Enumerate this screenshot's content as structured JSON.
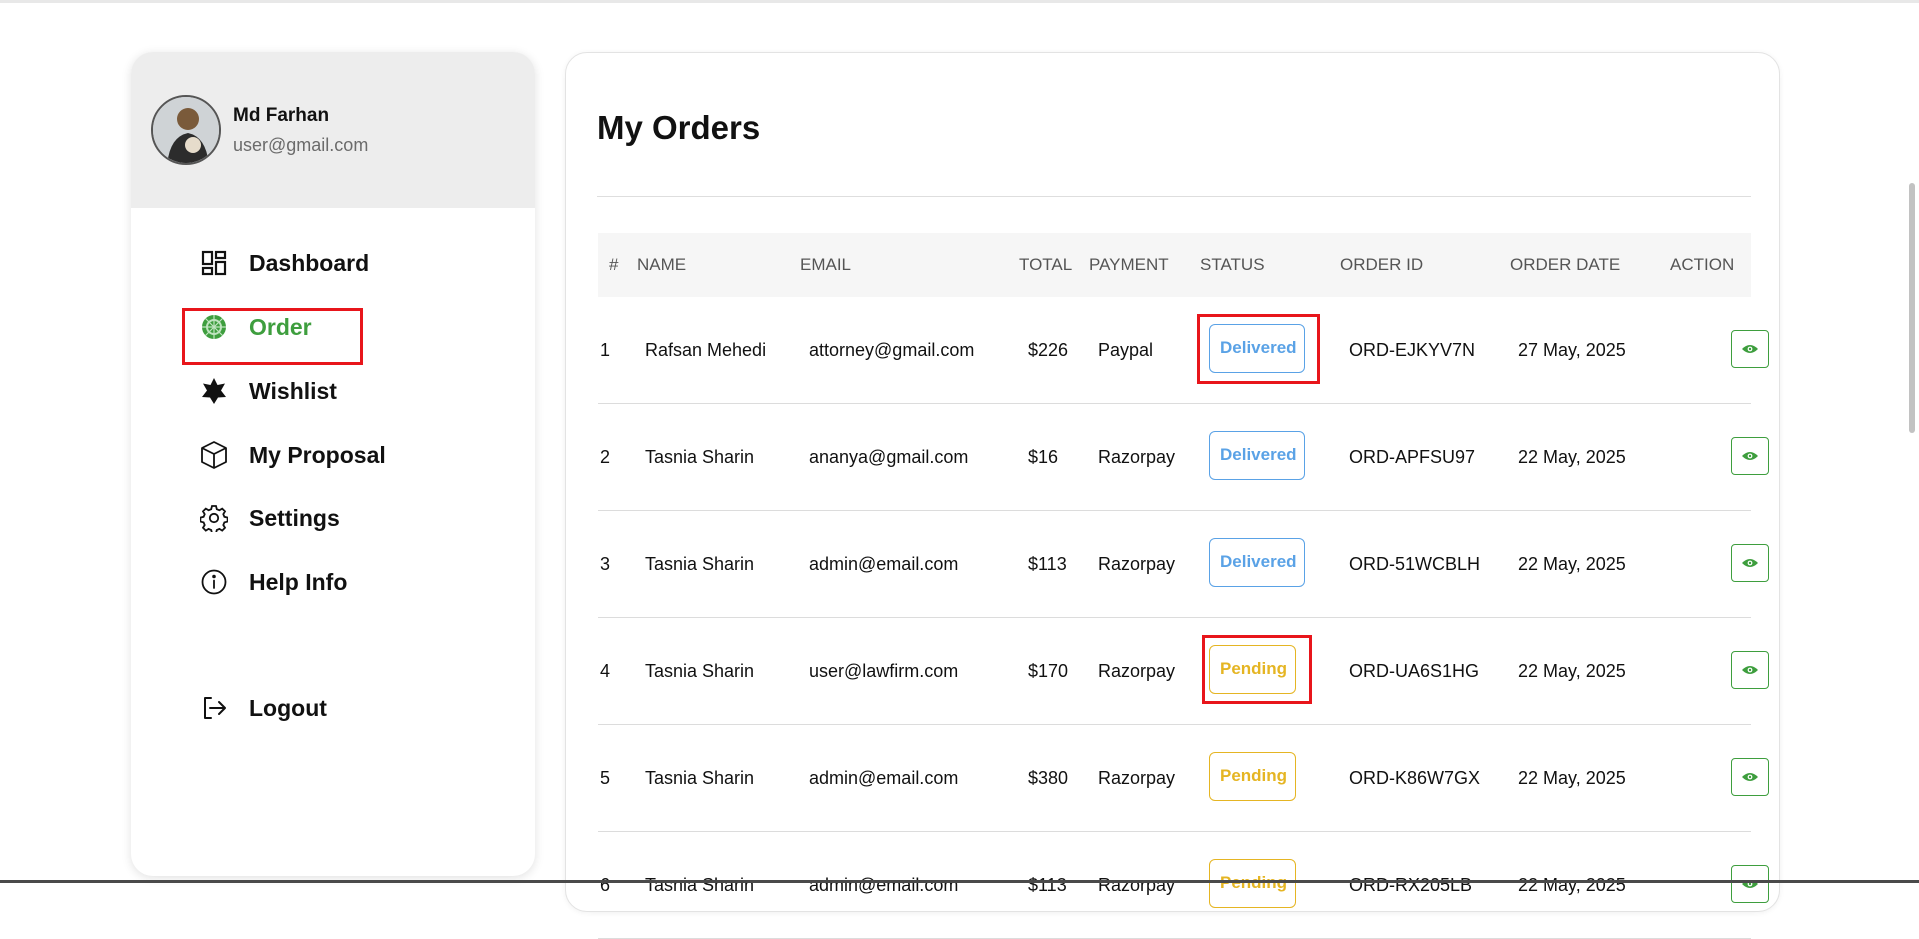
{
  "user": {
    "name": "Md Farhan",
    "email": "user@gmail.com"
  },
  "nav": {
    "items": [
      {
        "label": "Dashboard",
        "icon": "dashboard-icon"
      },
      {
        "label": "Order",
        "icon": "order-icon",
        "active": true
      },
      {
        "label": "Wishlist",
        "icon": "star-icon"
      },
      {
        "label": "My Proposal",
        "icon": "box-icon"
      },
      {
        "label": "Settings",
        "icon": "gear-icon"
      },
      {
        "label": "Help Info",
        "icon": "info-icon"
      }
    ],
    "logout_label": "Logout"
  },
  "page": {
    "title": "My Orders"
  },
  "table": {
    "columns": [
      "#",
      "NAME",
      "EMAIL",
      "TOTAL",
      "PAYMENT",
      "STATUS",
      "ORDER ID",
      "ORDER DATE",
      "ACTION"
    ],
    "rows": [
      {
        "num": "1",
        "name": "Rafsan Mehedi",
        "email": "attorney@gmail.com",
        "total": "$226",
        "payment": "Paypal",
        "status": "Delivered",
        "order_id": "ORD-EJKYV7N",
        "date": "27 May, 2025"
      },
      {
        "num": "2",
        "name": "Tasnia Sharin",
        "email": "ananya@gmail.com",
        "total": "$16",
        "payment": "Razorpay",
        "status": "Delivered",
        "order_id": "ORD-APFSU97",
        "date": "22 May, 2025"
      },
      {
        "num": "3",
        "name": "Tasnia Sharin",
        "email": "admin@email.com",
        "total": "$113",
        "payment": "Razorpay",
        "status": "Delivered",
        "order_id": "ORD-51WCBLH",
        "date": "22 May, 2025"
      },
      {
        "num": "4",
        "name": "Tasnia Sharin",
        "email": "user@lawfirm.com",
        "total": "$170",
        "payment": "Razorpay",
        "status": "Pending",
        "order_id": "ORD-UA6S1HG",
        "date": "22 May, 2025"
      },
      {
        "num": "5",
        "name": "Tasnia Sharin",
        "email": "admin@email.com",
        "total": "$380",
        "payment": "Razorpay",
        "status": "Pending",
        "order_id": "ORD-K86W7GX",
        "date": "22 May, 2025"
      },
      {
        "num": "6",
        "name": "Tasnia Sharin",
        "email": "admin@email.com",
        "total": "$113",
        "payment": "Razorpay",
        "status": "Pending",
        "order_id": "ORD-RX205LB",
        "date": "22 May, 2025"
      }
    ]
  },
  "colors": {
    "accent_green": "#3e9e3e",
    "delivered_blue": "#5aa2e6",
    "pending_yellow": "#e5b523",
    "highlight_red": "#e8151b"
  }
}
